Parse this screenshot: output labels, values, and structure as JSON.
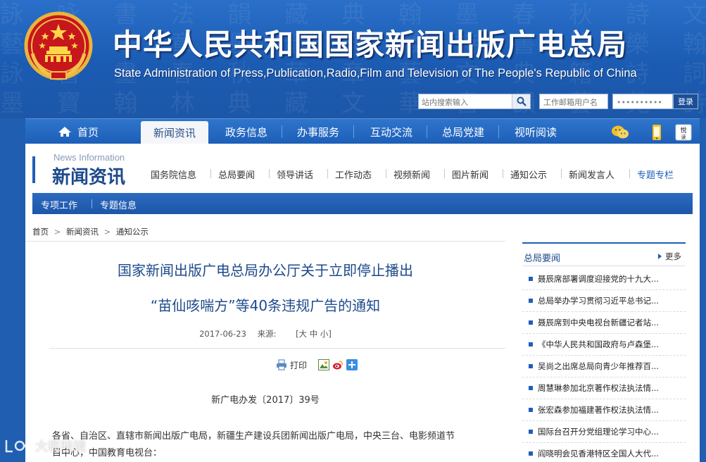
{
  "header": {
    "title_cn": "中华人民共和国国家新闻出版广电总局",
    "title_en": "State Administration of Press,Publication,Radio,Film and Television of The People's Republic of China",
    "search_placeholder": "站内搜索输入",
    "mail_placeholder": "工作邮箱用户名",
    "password_mask": "••••••••••",
    "login_label": "登录"
  },
  "mainnav": {
    "items": [
      "首页",
      "新闻资讯",
      "政务信息",
      "办事服务",
      "互动交流",
      "总局党建",
      "视听阅读"
    ],
    "active_index": 1,
    "accent_color": "#1d5fb8"
  },
  "section": {
    "title_en": "News Information",
    "title_cn": "新闻资讯",
    "subnav": [
      "国务院信息",
      "总局要闻",
      "领导讲话",
      "工作动态",
      "视频新闻",
      "图片新闻",
      "通知公示",
      "新闻发言人",
      "专题专栏"
    ],
    "thirdnav": [
      "专项工作",
      "专题信息"
    ]
  },
  "breadcrumb": {
    "items": [
      "首页",
      "新闻资讯",
      "通知公示"
    ],
    "separator": ">"
  },
  "article": {
    "title_line1": "国家新闻出版广电总局办公厅关于立即停止播出",
    "title_line2": "“苗仙咳喘方”等40条违规广告的通知",
    "date": "2017-06-23",
    "source_label": "来源:",
    "font_size_controls": "[大 中 小]",
    "print_label": "打印",
    "doc_number": "新广电办发〔2017〕39号",
    "body_line1": "各省、自治区、直辖市新闻出版广电局，新疆生产建设兵团新闻出版广电局，中央三台、电影频道节",
    "body_line2": "目中心，中国教育电视台："
  },
  "sidebar": {
    "title": "总局要闻",
    "more_label": "更多",
    "items": [
      "聂辰席部署调度迎接党的十九大...",
      "总局举办学习贯彻习近平总书记...",
      "聂辰席到中央电视台新疆记者站...",
      "《中华人民共和国政府与卢森堡...",
      "吴尚之出席总局向青少年推荐百...",
      "周慧琳参加北京著作权法执法情...",
      "张宏森参加福建著作权法执法情...",
      "国际台召开分党组理论学习中心...",
      "阎晓明会见香港特区全国人大代..."
    ]
  },
  "watermark": {
    "text": "大榄晓镜"
  }
}
